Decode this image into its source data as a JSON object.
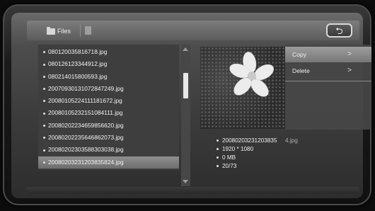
{
  "header": {
    "tab_label": "Files",
    "back_symbol": "⮌",
    "tab_icon": "folder-icon",
    "second_tab_icon": "document-icon"
  },
  "file_list": {
    "items": [
      "080120035816718.jpg",
      "080126123344912.jpg",
      "080214015800593.jpg",
      "20070930131072847249.jpg",
      "20080105224111181672.jpg",
      "20080105232151084111.jpg",
      "20080202234659856620.jpg",
      "20080202235646862073.jpg",
      "20080202303588303038.jpg",
      "20080203231203835824.jpg"
    ],
    "selected_index": 9
  },
  "context_menu": {
    "items": [
      {
        "label": "Copy",
        "arrow": ">"
      },
      {
        "label": "Delete",
        "arrow": ">"
      }
    ],
    "highlighted_index": 0
  },
  "file_info": {
    "filename_visible": "20080203231203835",
    "filename_tail": "4.jpg",
    "resolution": "1920 * 1080",
    "size": "0 MB",
    "position": "20/73"
  },
  "colors": {
    "selected_row": "#7d7d7d",
    "text": "#f2f2f2",
    "panel": "#3e3e3e"
  }
}
